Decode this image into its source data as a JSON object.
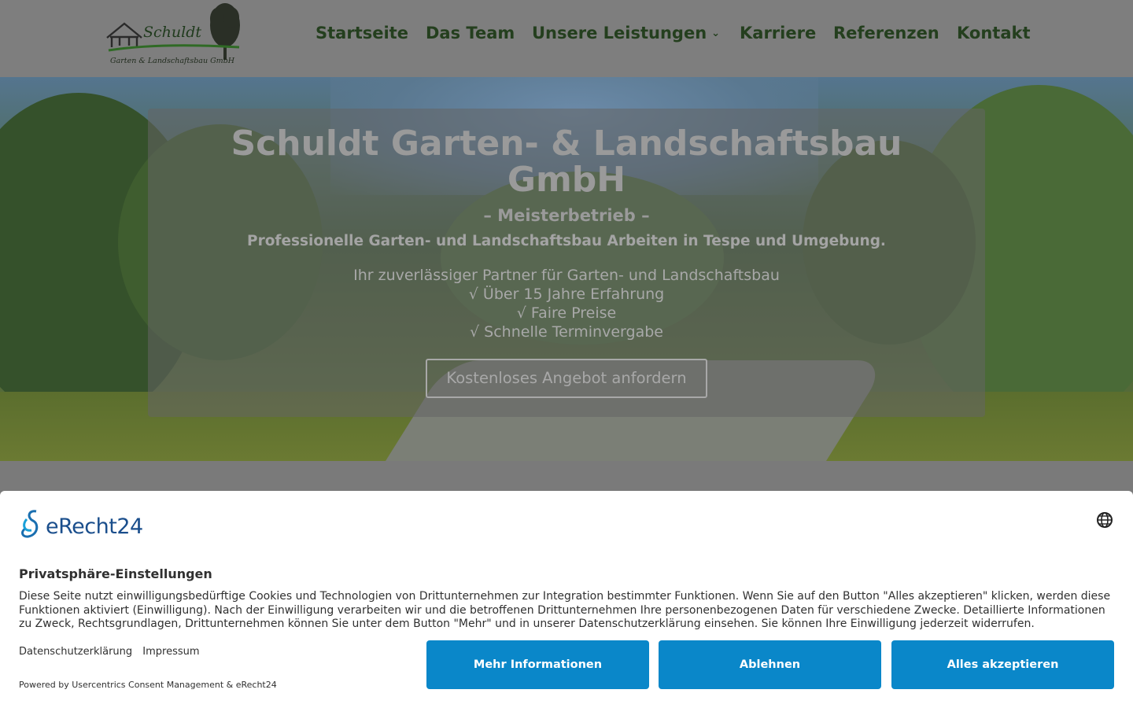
{
  "header": {
    "logo_name": "Schuldt",
    "logo_subtitle": "Garten & Landschaftsbau GmbH",
    "nav": [
      {
        "label": "Startseite"
      },
      {
        "label": "Das Team"
      },
      {
        "label": "Unsere Leistungen",
        "has_dropdown": true
      },
      {
        "label": "Karriere"
      },
      {
        "label": "Referenzen"
      },
      {
        "label": "Kontakt"
      }
    ]
  },
  "hero": {
    "title_line1": "Schuldt Garten- & Landschaftsbau",
    "title_line2": "GmbH",
    "subtitle": "– Meisterbetrieb –",
    "tagline": "Professionelle Garten- und Landschaftsbau Arbeiten in Tespe und Umgebung.",
    "lines": [
      "Ihr zuverlässiger Partner für Garten- und Landschaftsbau",
      "√ Über 15 Jahre Erfahrung",
      "√ Faire Preise",
      "√ Schnelle Terminvergabe"
    ],
    "cta_label": "Kostenloses Angebot anfordern"
  },
  "consent": {
    "brand": "eRecht24",
    "title": "Privatsphäre-Einstellungen",
    "text": "Diese Seite nutzt einwilligungsbedürftige Cookies und Technologien von Drittunternehmen zur Integration bestimmter Funktionen. Wenn Sie auf den Button \"Alles akzeptieren\" klicken, werden diese Funktionen aktiviert (Einwilligung). Nach der Einwilligung verarbeiten wir und die betroffenen Drittunternehmen Ihre personenbezogenen Daten für verschiedene Zwecke. Detaillierte Informationen zu Zweck, Rechtsgrundlagen, Drittunternehmen können Sie unter dem Button \"Mehr\" und in unserer Datenschutzerklärung einsehen. Sie können Ihre Einwilligung jederzeit widerrufen.",
    "link_privacy": "Datenschutzerklärung",
    "link_imprint": "Impressum",
    "powered_by": "Powered by Usercentrics Consent Management & eRecht24",
    "buttons": {
      "more": "Mehr Informationen",
      "deny": "Ablehnen",
      "accept_all": "Alles akzeptieren"
    },
    "button_color": "#0a87c9"
  },
  "colors": {
    "nav_text": "#243f1e",
    "overlay": "#7e7e7e"
  }
}
